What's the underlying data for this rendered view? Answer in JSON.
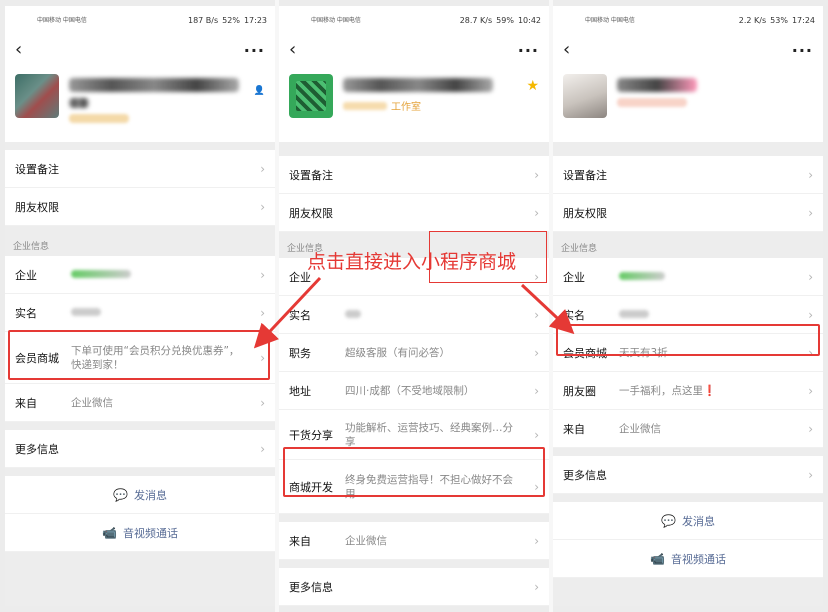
{
  "status": {
    "p1": {
      "carrier": "中国移动 中国电信",
      "speed": "187 B/s",
      "battery": "52%",
      "time": "17:23"
    },
    "p2": {
      "carrier": "中国移动 中国电信",
      "speed": "28.7 K/s",
      "battery": "59%",
      "time": "10:42"
    },
    "p3": {
      "carrier": "中国移动 中国电信",
      "speed": "2.2 K/s",
      "battery": "53%",
      "time": "17:24"
    }
  },
  "icons": {
    "back": "back-icon",
    "more": "more-icon",
    "chevron": "chevron-right-icon",
    "chat": "chat-bubble-icon",
    "video": "video-call-icon",
    "star": "star-icon"
  },
  "phone1": {
    "rows_top": [
      {
        "label": "设置备注"
      },
      {
        "label": "朋友权限"
      }
    ],
    "section_title": "企业信息",
    "rows_info": [
      {
        "label": "企业",
        "value": ""
      },
      {
        "label": "实名",
        "value": ""
      },
      {
        "label": "会员商城",
        "value": "下单可使用“会员积分兑换优惠券”，快递到家！"
      },
      {
        "label": "来自",
        "value": "企业微信"
      },
      {
        "label": "更多信息",
        "value": ""
      }
    ],
    "send_message": "发消息",
    "video_call": "音视频通话"
  },
  "phone2": {
    "company_suffix": "工作室",
    "rows_top": [
      {
        "label": "设置备注"
      },
      {
        "label": "朋友权限"
      }
    ],
    "section_title": "企业信息",
    "rows_info": [
      {
        "label": "企业",
        "value": ""
      },
      {
        "label": "实名",
        "value": ""
      },
      {
        "label": "职务",
        "value": "超级客服（有问必答）"
      },
      {
        "label": "地址",
        "value": "四川·成都（不受地域限制）"
      },
      {
        "label": "干货分享",
        "value": "功能解析、运营技巧、经典案例…分享"
      },
      {
        "label": "商城开发",
        "value": "终身免费运营指导！不担心做好不会用"
      },
      {
        "label": "来自",
        "value": "企业微信"
      },
      {
        "label": "更多信息",
        "value": ""
      }
    ]
  },
  "phone3": {
    "rows_top": [
      {
        "label": "设置备注"
      },
      {
        "label": "朋友权限"
      }
    ],
    "section_title": "企业信息",
    "rows_info": [
      {
        "label": "企业",
        "value": ""
      },
      {
        "label": "实名",
        "value": ""
      },
      {
        "label": "会员商城",
        "value": "天天有3折"
      },
      {
        "label": "朋友圈",
        "value": "一手福利，点这里❗"
      },
      {
        "label": "来自",
        "value": "企业微信"
      },
      {
        "label": "更多信息",
        "value": ""
      }
    ],
    "send_message": "发消息",
    "video_call": "音视频通话"
  },
  "annotation": {
    "callout_text": "点击直接进入小程序商城",
    "accent_color": "#e53935"
  }
}
